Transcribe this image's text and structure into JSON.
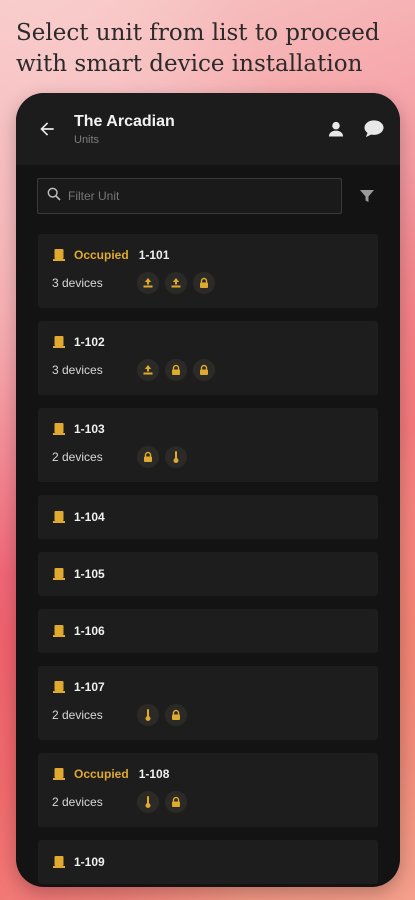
{
  "headline": "Select unit from list to proceed with smart device installation",
  "header": {
    "title": "The Arcadian",
    "subtitle": "Units"
  },
  "search": {
    "placeholder": "Filter Unit"
  },
  "colors": {
    "accent": "#e0a930",
    "card": "#1d1d1d",
    "background": "#131313"
  },
  "units": [
    {
      "status": "Occupied",
      "number": "1-101",
      "devices": "3 devices",
      "icons": [
        "thermostat-icon",
        "thermostat-icon",
        "lock-icon"
      ]
    },
    {
      "status": "",
      "number": "1-102",
      "devices": "3 devices",
      "icons": [
        "thermostat-icon",
        "lock-icon",
        "lock-icon"
      ]
    },
    {
      "status": "",
      "number": "1-103",
      "devices": "2 devices",
      "icons": [
        "lock-icon",
        "temperature-sensor-icon"
      ]
    },
    {
      "status": "",
      "number": "1-104",
      "devices": "",
      "icons": []
    },
    {
      "status": "",
      "number": "1-105",
      "devices": "",
      "icons": []
    },
    {
      "status": "",
      "number": "1-106",
      "devices": "",
      "icons": []
    },
    {
      "status": "",
      "number": "1-107",
      "devices": "2 devices",
      "icons": [
        "temperature-sensor-icon",
        "lock-icon"
      ]
    },
    {
      "status": "Occupied",
      "number": "1-108",
      "devices": "2 devices",
      "icons": [
        "temperature-sensor-icon",
        "lock-icon"
      ]
    },
    {
      "status": "",
      "number": "1-109",
      "devices": "",
      "icons": []
    }
  ]
}
